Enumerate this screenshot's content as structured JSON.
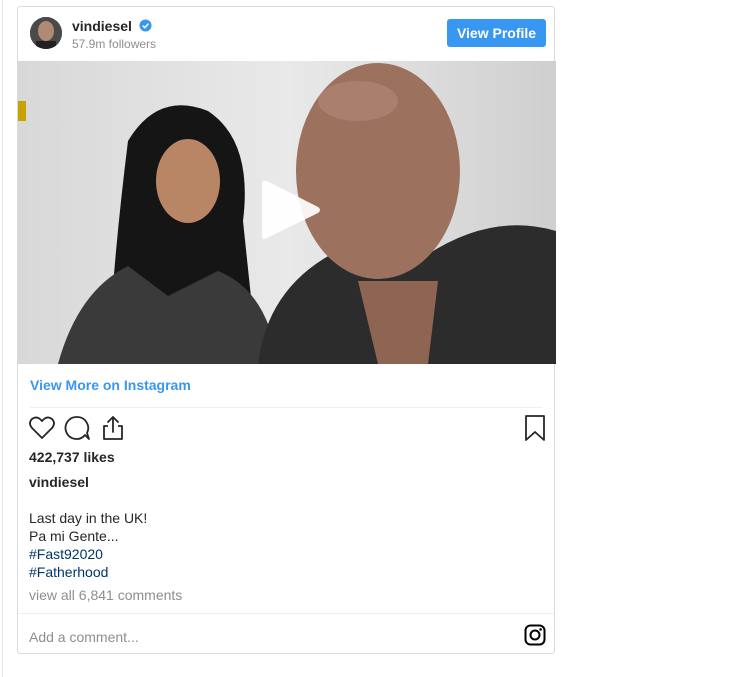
{
  "header": {
    "username": "vindiesel",
    "followers": "57.9m followers",
    "view_profile_label": "View Profile"
  },
  "media": {
    "type": "video"
  },
  "links": {
    "view_more": "View More on Instagram"
  },
  "post": {
    "likes": "422,737 likes",
    "caption_user": "vindiesel",
    "caption_lines": [
      "Last day in the UK!",
      "Pa mi Gente..."
    ],
    "hashtags": [
      "#Fast92020",
      "#Fatherhood"
    ],
    "view_comments": "view all 6,841 comments"
  },
  "comment_box": {
    "placeholder": "Add a comment..."
  },
  "colors": {
    "accent": "#3897f0",
    "hashtag": "#003569",
    "muted": "#8e8e8e",
    "text": "#262626"
  },
  "icons": [
    "verified-badge-icon",
    "play-icon",
    "heart-icon",
    "comment-icon",
    "share-icon",
    "bookmark-icon",
    "instagram-glyph-icon"
  ]
}
